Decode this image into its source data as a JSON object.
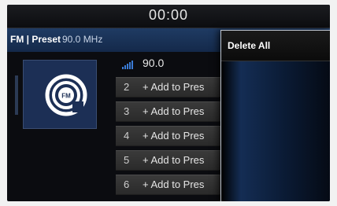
{
  "status": {
    "clock": "00:00"
  },
  "header": {
    "mode": "FM | Preset",
    "frequency": "90.0 MHz"
  },
  "now_playing": {
    "station_logo": "FM",
    "frequency": "90.0",
    "signal_icon": "signal-strength-icon"
  },
  "presets": [
    {
      "number": "2",
      "label": "+ Add to Pres"
    },
    {
      "number": "3",
      "label": "+ Add to Pres"
    },
    {
      "number": "4",
      "label": "+ Add to Pres"
    },
    {
      "number": "5",
      "label": "+ Add to Pres"
    },
    {
      "number": "6",
      "label": "+ Add to Pres"
    }
  ],
  "menu": {
    "items": [
      "Delete All"
    ]
  },
  "colors": {
    "accent": "#1f3b63",
    "popup_border": "#bfc6d0",
    "logo_ring": "#ffffff"
  }
}
